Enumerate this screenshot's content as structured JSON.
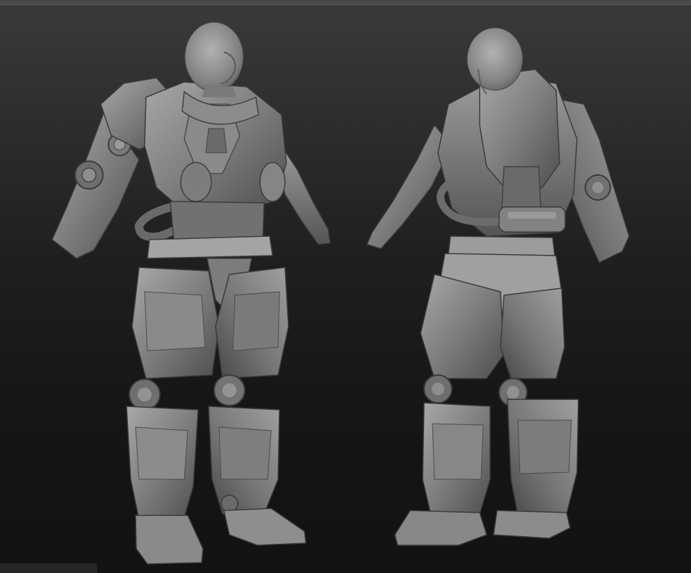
{
  "scene": {
    "subject": "armored-character-sculpt",
    "views": [
      "front-three-quarter",
      "back-three-quarter"
    ],
    "colors": {
      "background_top": "#3a3a3a",
      "background_bottom": "#121212",
      "clay_light": "#9a9a9a",
      "clay_mid": "#777777",
      "clay_dark": "#4a4a4a",
      "clay_shadow": "#2c2c2c"
    }
  }
}
